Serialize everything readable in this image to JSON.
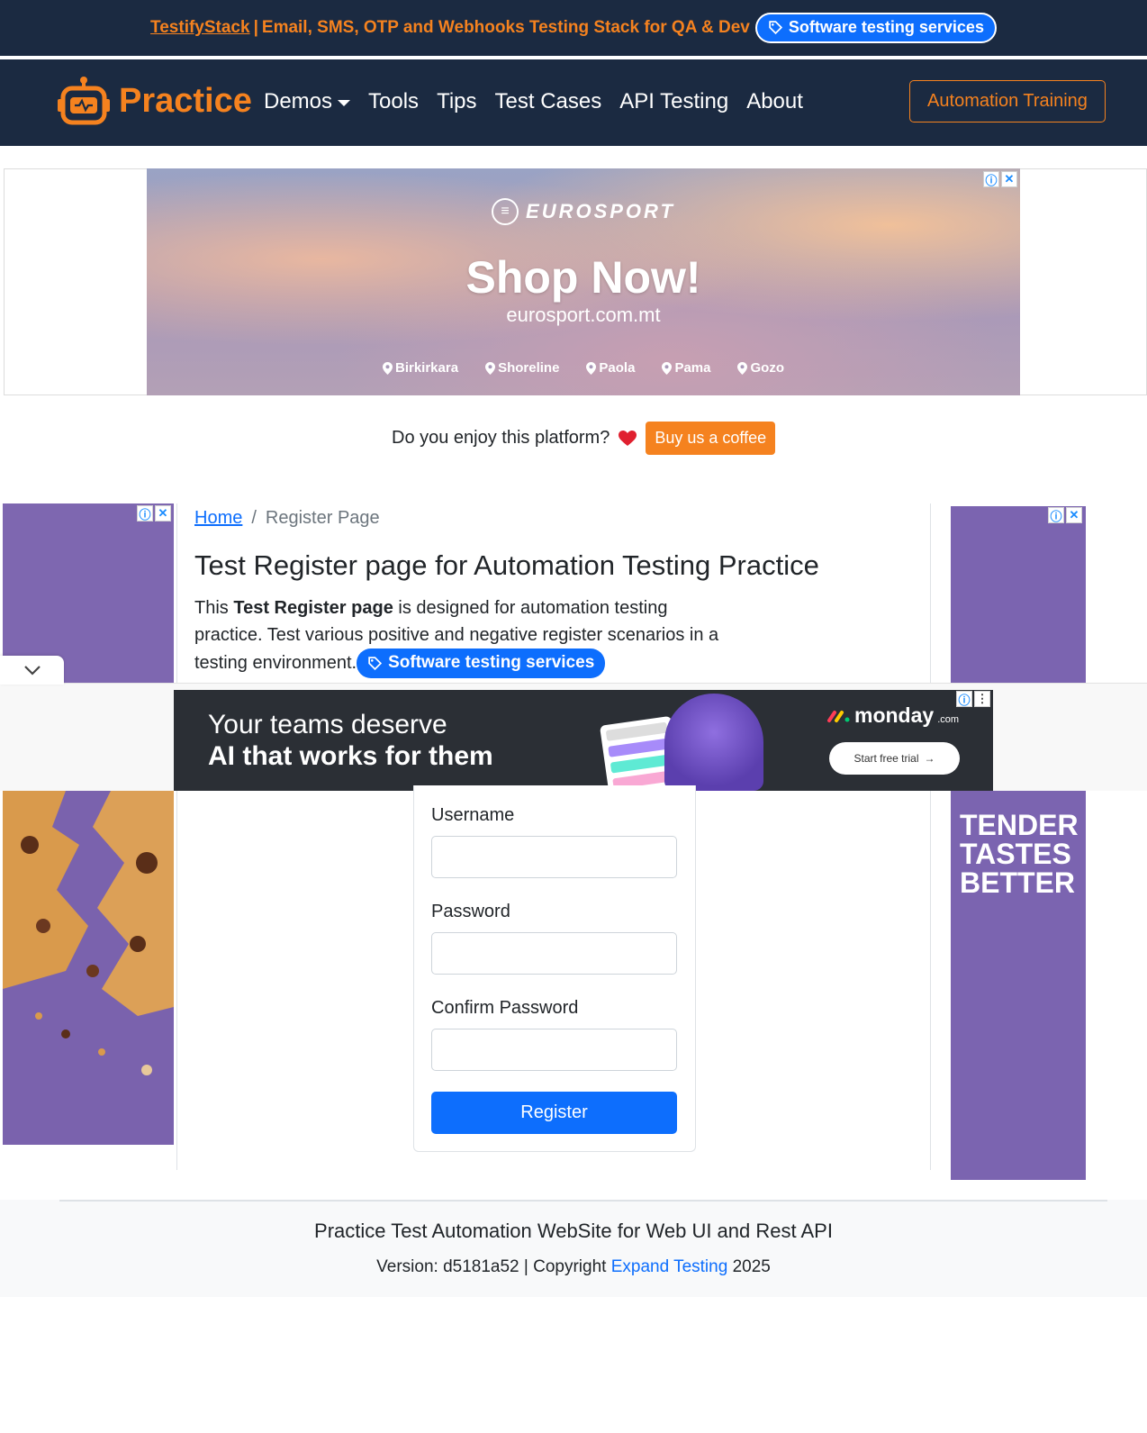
{
  "promo": {
    "link": "TestifyStack",
    "separator": "|",
    "text": "Email, SMS, OTP and Webhooks Testing Stack for QA & Dev",
    "pill": "Software testing services"
  },
  "navbar": {
    "brand": "Practice",
    "items": [
      "Demos",
      "Tools",
      "Tips",
      "Test Cases",
      "API Testing",
      "About"
    ],
    "cta": "Automation Training"
  },
  "ad_top": {
    "brand": "EUROSPORT",
    "headline": "Shop Now!",
    "url": "eurosport.com.mt",
    "locations": [
      "Birkirkara",
      "Shoreline",
      "Paola",
      "Pama",
      "Gozo"
    ]
  },
  "coffee": {
    "question": "Do you enjoy this platform?",
    "button": "Buy us a coffee"
  },
  "breadcrumb": {
    "home": "Home",
    "separator": "/",
    "current": "Register Page"
  },
  "main": {
    "title": "Test Register page for Automation Testing Practice",
    "intro_prefix": "This",
    "intro_bold": "Test Register page",
    "intro_rest": "is designed for automation testing practice. Test various positive and negative register scenarios in a testing environment.",
    "pill": "Software testing services"
  },
  "anchor_ad": {
    "line1": "Your teams deserve",
    "line2": "AI that works for them",
    "brand": "monday",
    "brand_suffix": ".com",
    "cta": "Start free trial"
  },
  "side_ad": {
    "text": "TENDER TASTES BETTER"
  },
  "form": {
    "username_label": "Username",
    "password_label": "Password",
    "confirm_label": "Confirm Password",
    "submit": "Register",
    "username_value": "",
    "password_value": "",
    "confirm_value": ""
  },
  "footer": {
    "title": "Practice Test Automation WebSite for Web UI and Rest API",
    "version_text": "Version: d5181a52 | Copyright",
    "link": "Expand Testing",
    "year": "2025"
  },
  "colors": {
    "navy": "#1b2a41",
    "orange": "#f5821f",
    "primary": "#0d6efd",
    "ad_purple": "#7b64b0"
  }
}
